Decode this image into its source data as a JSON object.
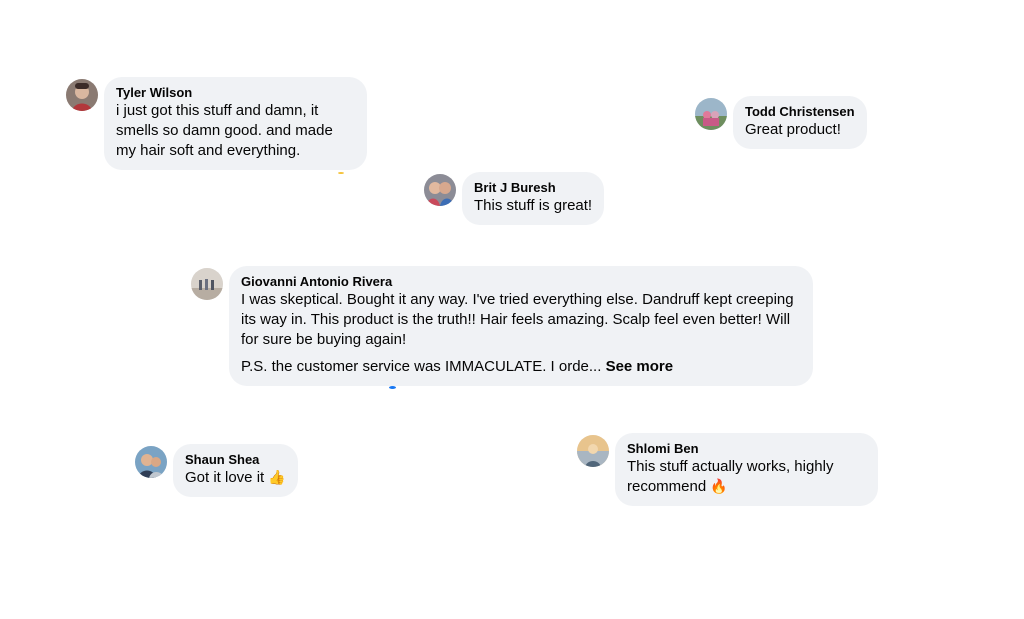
{
  "comments": [
    {
      "name": "Tyler Wilson",
      "text": "i just got this stuff and damn, it smells so damn good. and made my hair soft and everything."
    },
    {
      "name": "Todd Christensen",
      "text": "Great product!"
    },
    {
      "name": "Brit J Buresh",
      "text": "This stuff is great!"
    },
    {
      "name": "Giovanni Antonio Rivera",
      "text": "I was skeptical. Bought it any way. I've tried everything else. Dandruff kept creeping its way in. This product is the truth!! Hair feels amazing. Scalp feel even better! Will for sure be buying again!",
      "ps": "P.S. the customer service was IMMACULATE. I orde...",
      "see_more": "See more"
    },
    {
      "name": "Shaun Shea",
      "text": "Got it love it",
      "emoji": "👍"
    },
    {
      "name": "Shlomi Ben",
      "text": "This stuff actually works, highly recommend",
      "emoji": "🔥"
    }
  ],
  "colors": {
    "bubble": "#f0f2f5",
    "text": "#050505",
    "reaction_blue": "#1877f2"
  },
  "icons": {
    "avatar": "profile-photo-avatar",
    "thumbs_up": "thumbs-up-emoji",
    "fire": "fire-emoji"
  }
}
